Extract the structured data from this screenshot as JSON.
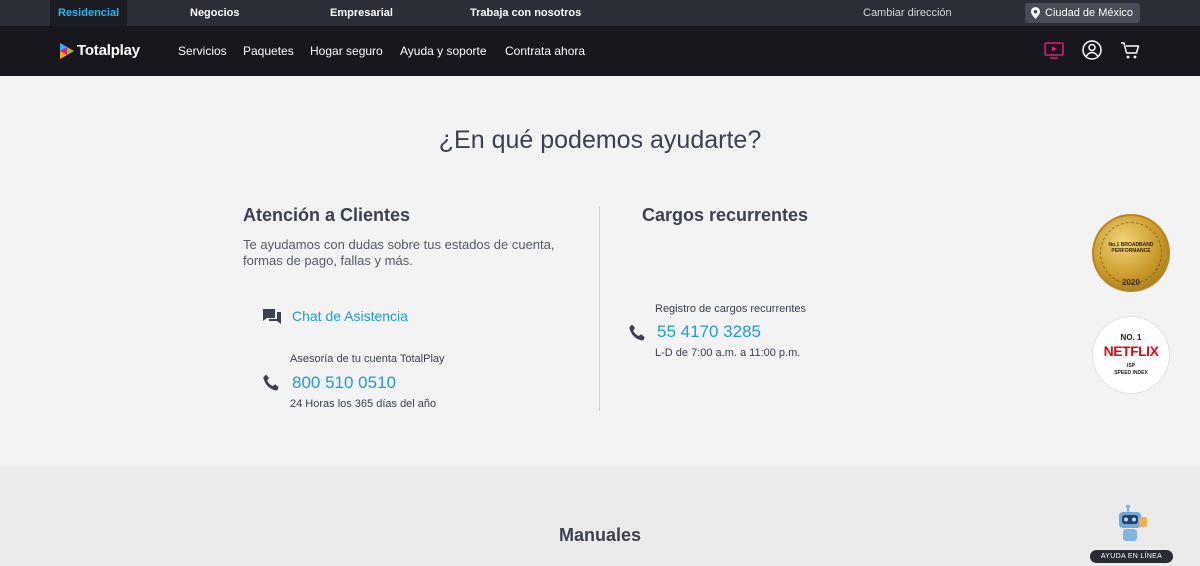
{
  "topbar": {
    "segments": [
      "Residencial",
      "Negocios",
      "Empresarial",
      "Trabaja con nosotros"
    ],
    "change_address": "Cambiar dirección",
    "city": "Ciudad de México"
  },
  "nav": {
    "brand": "Totalplay",
    "links": [
      "Servicios",
      "Paquetes",
      "Hogar seguro",
      "Ayuda y soporte",
      "Contrata ahora"
    ],
    "icons": [
      "tv-icon",
      "user-icon",
      "cart-icon"
    ]
  },
  "help": {
    "title": "¿En qué podemos ayudarte?",
    "clientes": {
      "heading": "Atención a Clientes",
      "description_line1": "Te ayudamos con dudas sobre tus estados de cuenta,",
      "description_line2": "formas de pago, fallas y más.",
      "chat_label": "Chat de Asistencia",
      "phone_caption": "Asesoría de tu cuenta TotalPlay",
      "phone": "800 510 0510",
      "hours": "24 Horas los 365 días del año"
    },
    "cargos": {
      "heading": "Cargos recurrentes",
      "phone_caption": "Registro de cargos recurrentes",
      "phone": "55 4170 3285",
      "hours": "L-D de 7:00 a.m. a 11:00 p.m."
    }
  },
  "badges": {
    "broadband_line1": "No.1 BROADBAND",
    "broadband_line2": "PERFORMANCE",
    "broadband_year": "2020",
    "netflix_no": "NO. 1",
    "netflix_brand": "NETFLIX",
    "netflix_line1": "ISP",
    "netflix_line2": "SPEED INDEX"
  },
  "manuales": {
    "title": "Manuales",
    "help_button": "AYUDA EN LÍNEA"
  },
  "colors": {
    "accent_blue": "#1e9be0",
    "active_tab": "#2ab6f6",
    "nav_bg": "#17171d",
    "topbar_bg": "#2b2e36"
  }
}
